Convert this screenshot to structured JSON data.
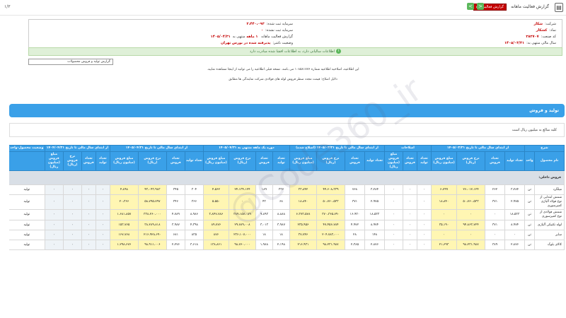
{
  "topbar": {
    "title": "گزارش فعالیت ماهانه",
    "badge": "گزارش فعالیت ماه",
    "page_number": "۱/۳",
    "prev_label": "<",
    "next_label": ">"
  },
  "info": {
    "company_label": "شرکت:",
    "company_value": "شکار",
    "symbol_label": "نماد:",
    "symbol_value": "کشکار",
    "code_label": "کد صنعت:",
    "code_value": "۳۸۳۷۰۷",
    "year_label": "سال مالی منتهی به:",
    "year_value": "۱۴۰۵/۰۳/۳۱",
    "capital_label": "سرمایه ثبت شده:",
    "capital_value": "۲،۴۴۰،۰۹۳",
    "unreg_capital_label": "سرمایه ثبت نشده:",
    "unreg_capital_value": "۰",
    "report_label": "گزارش فعالیت ماهانه",
    "months_label": "۱ ماهه",
    "ending_label": "منتهی به",
    "ending_value": "۱۴۰۵/۰۴/۳۱",
    "status_label": "وضعیت ناشر:",
    "status_value": "پذیرفته شده در بورس تهران"
  },
  "notice": "اطلاعات سالیانی دارد، به اطلاعات افشا شده مبادرت دارد",
  "select_value": "گزارش تولید و فروش محصولات",
  "desc1": "این اطلاعیه، اصلاحیه اطلاعیه شماره ۱۰۸۵۸۱۷۷۶ می باشد. نسخه قبلی اطلاعیه را می توانید از اینجا مشاهده نمایید.",
  "desc2": "دلایل اصلاح: قیمت مجدد سطر فروش لوله های فولادی شرکت نمایندگی ها مطابق",
  "section_title": "تولید و فروش",
  "unit_text": "کلیه مبالغ به میلیون ریال است",
  "table": {
    "headers_top": [
      "شرح",
      "از ابتدای سال مالی تا تاریخ ۱۴۰۵/۰۳/۳۱",
      "اصلاحات",
      "از ابتدای سال مالی تا تاریخ ۱۴۰۵/۰۳/۳۱ (اصلاح شده)",
      "دوره یک ماهه منتهی به ۱۴۰۵/۰۴/۳۱",
      "از ابتدای سال مالی تا تاریخ ۱۴۰۵/۰۴/۳۱",
      "از ابتدای سال مالی تا تاریخ ۱۴۰۴/۰۴/۳۱",
      "وضعیت محصول-واحد"
    ],
    "headers_sub": [
      "نام محصول",
      "واحد",
      "تعداد تولید",
      "تعداد فروش",
      "نرخ فروش (ریال)",
      "مبلغ فروش (میلیون ریال)",
      "تعداد تولید",
      "تعداد فروش",
      "مبلغ فروش (میلیون ریال)",
      "تعداد تولید",
      "تعداد فروش",
      "نرخ فروش (ریال)",
      "مبلغ فروش (میلیون ریال)",
      "تعداد تولید",
      "تعداد فروش",
      "نرخ فروش (ریال)",
      "مبلغ فروش (میلیون ریال)",
      "تعداد تولید",
      "تعداد فروش",
      "نرخ فروش (ریال)",
      "مبلغ فروش (میلیون ریال)",
      "تعداد تولید",
      "تعداد فروش",
      "نرخ فروش (ریال)",
      "مبلغ فروش (میلیون ریال)",
      ""
    ],
    "group_label": "فروش داخلی:",
    "rows": [
      [
        "میلگرد",
        "تن",
        "۳،۲۸۴",
        "۲۶۲",
        "۲۶،۰۱۲،۱۲۴",
        "۶،۷۹۹",
        "۰",
        "۰",
        "۰",
        "۳،۲۸۴",
        "۷۶۸",
        "۴۴،۶۰۸،۳۳۹",
        "۳۳،۸۴۲",
        "۳۳۷",
        "۱۸۹",
        "۲۴،۱۳۴،۱۲۴",
        "۴،۵۶۲",
        "۳۰۴",
        "۳۴۵",
        "۴۳،۰۴۳،۹۸۳",
        "۴،۸۹۸",
        "۰",
        "۰",
        "۰",
        "۰",
        "تولید"
      ],
      [
        "شمش ابتدایی از نوع فولاد آلیاژی کمپرسوری",
        "تن",
        "۲،۹۷۵",
        "۳۷۱",
        "۵۰،۷۶۰،۵۳۳",
        "۱۸،۸۴۰",
        "۰",
        "۰",
        "۰",
        "۲،۹۷۵",
        "۳۷۱",
        "۵۰،۷۶۰،۵۳۳",
        "۱۸،۸۴۰",
        "۶۸",
        "۴۳",
        "۰",
        "۵،۵۵۰",
        "۳۶۶",
        "۳۴۶",
        "۵۸،۷۹۵،۷۹۷",
        "۲۰،۳۶۶",
        "۰",
        "۰",
        "۰",
        "۰",
        "تولید"
      ],
      [
        "شمش فولادی از نوع کمپرسوری",
        "تن",
        "۱۸،۵۳۳",
        "۰",
        "۰",
        "۰",
        "۰",
        "۰",
        "۰",
        "۱۸،۵۳۳",
        "۱۶،۹۳۰",
        "۳۷۰،۳۶۵،۷۹۰",
        "۶،۳۷۳،۵۷۸",
        "۸،۸۸۸",
        "۹،۸۹۳",
        "۳۸۹،۱۵۷،۰۸۹",
        "۳،۸۴۷،۷۸۶",
        "۸،۹۸۶",
        "۴،۷۸۹",
        "۳۳۸،۲۶۰،۰۰۰",
        "۱،۶۸۱،۸۵۷",
        "۰",
        "۰",
        "۰",
        "۰",
        "تولید"
      ],
      [
        "لوله تکنیکی آلیاژی",
        "تن",
        "۸،۹۷۴",
        "۳۷۱",
        "۹۴،۸۶۳،۷۲۴",
        "۳۵،۱۹۰",
        "۰",
        "۰",
        "۰",
        "۸،۹۷۴",
        "۴،۹۷۲",
        "۴۷،۴۵۶،۷۸۴",
        "۲۳۵،۹۵۶",
        "۳،۹۸۷",
        "۳،۰۱۳",
        "۲۹،۷۸۹،۰۰۸",
        "۸۹،۷۷۶",
        "۴،۳۹۸",
        "۳،۹۸۷",
        "۳۸،۲۸۹،۸۱۸",
        "۱۵۳،۷۶۵",
        "۰",
        "۰",
        "۰",
        "۰",
        "تولید"
      ],
      [
        "سایر",
        "تن",
        "۰",
        "۰",
        "۰",
        "۰",
        "۰",
        "۰",
        "۰",
        "۱۴۸",
        "۲۸",
        "۲۰۴،۷۸۳،۰۰۰",
        "۳۷،۷۴۶",
        "۱۸",
        "۱۸",
        "۲۳۶،۱۰۷،۰۰۰",
        "۸۷۶",
        "۸۳۵",
        "۶۸۱",
        "۲۱۶،۹۲۸،۶۹۰",
        "۱۶۷،۷۶۸",
        "۰",
        "۰",
        "۰",
        "۰",
        "تولید"
      ],
      [
        "کالای بلوک",
        "تن",
        "۲،۸۷۶",
        "۳۸۹",
        "۹۸،۲۳۱،۹۸۷",
        "۲۱،۶۹۳",
        "۰",
        "۰",
        "۰",
        "۲،۸۷۶",
        "۲،۳۸۵",
        "۹۸،۲۳۱،۹۸۷",
        "۲۱۶،۹۳۱",
        "۲،۱۹۸",
        "۱،۹۸۸",
        "۹۸،۷۶۰،۰۰۰",
        "۱۳۸،۸۶۱",
        "۳،۶۱۸",
        "۲،۲۷۶",
        "۹۸،۹۱۱،۰۰۶",
        "۱،۲۹۸،۶۷۶",
        "۰",
        "۰",
        "۰",
        "۰",
        "تولید"
      ]
    ]
  },
  "watermark": "@Code360_ir"
}
